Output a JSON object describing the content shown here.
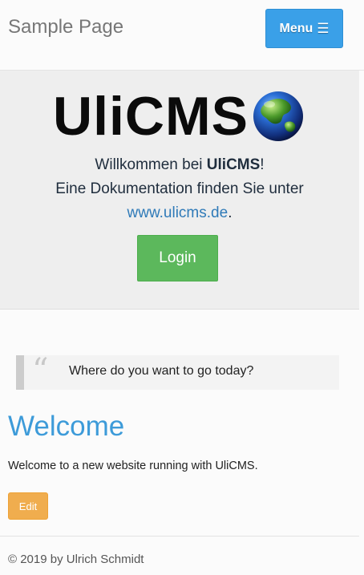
{
  "header": {
    "site_title": "Sample Page",
    "menu_label": "Menu",
    "menu_icon": "☰"
  },
  "jumbotron": {
    "logo_text": "UliCMS",
    "line1_prefix": "Willkommen bei ",
    "line1_brand": "UliCMS",
    "line1_suffix": "!",
    "line2": "Eine Dokumentation finden Sie unter",
    "link_text": "www.ulicms.de",
    "link_suffix": ".",
    "login_label": "Login"
  },
  "quote": {
    "mark": "“",
    "text": "Where do you want to go today?"
  },
  "content": {
    "heading": "Welcome",
    "paragraph": "Welcome to a new website running with UliCMS.",
    "edit_label": "Edit"
  },
  "footer": {
    "copyright": "© 2019 by Ulrich Schmidt"
  },
  "colors": {
    "menu_button": "#3aa0e8",
    "login_button": "#5cb85c",
    "edit_button": "#f0ad4e",
    "heading": "#3d9bd9",
    "link": "#2f7ab8"
  }
}
